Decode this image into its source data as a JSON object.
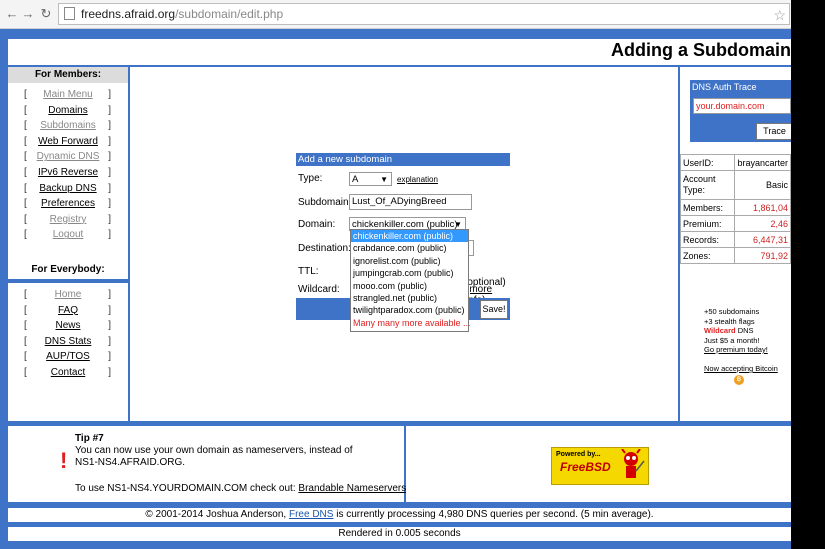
{
  "browser": {
    "url_host": "freedns.afraid.org",
    "url_path": "/subdomain/edit.php"
  },
  "header": {
    "title": "Adding a Subdomain"
  },
  "members": {
    "heading": "For Members:",
    "items": [
      {
        "label": "Main Menu"
      },
      {
        "label": "Domains"
      },
      {
        "label": "Subdomains"
      },
      {
        "label": "Web Forward"
      },
      {
        "label": "Dynamic DNS"
      },
      {
        "label": "IPv6 Reverse"
      },
      {
        "label": "Backup DNS"
      },
      {
        "label": "Preferences"
      },
      {
        "label": "Registry"
      },
      {
        "label": "Logout"
      }
    ]
  },
  "everybody": {
    "heading": "For Everybody:",
    "items": [
      {
        "label": "Home"
      },
      {
        "label": "FAQ"
      },
      {
        "label": "News"
      },
      {
        "label": "DNS Stats"
      },
      {
        "label": "AUP/TOS"
      },
      {
        "label": "Contact"
      }
    ]
  },
  "form": {
    "heading": "Add a new subdomain",
    "type_label": "Type:",
    "type_value": "A",
    "explanation_link": "explanation",
    "subdomain_label": "Subdomain:",
    "subdomain_value": "Lust_Of_ADyingBreed",
    "domain_label": "Domain:",
    "domain_value": "chickenkiller.com (public)",
    "destination_label": "Destination:",
    "ttl_label": "TTL:",
    "ttl_suffix": "s (optional)",
    "wildcard_label": "Wildcard:",
    "more_info_link": "(more info)",
    "save_label": "Save!"
  },
  "dropdown": {
    "options": [
      "chickenkiller.com (public)",
      "crabdance.com (public)",
      "ignorelist.com (public)",
      "jumpingcrab.com (public)",
      "mooo.com (public)",
      "strangled.net (public)",
      "twilightparadox.com (public)",
      "Many many more available ..."
    ]
  },
  "dns_trace": {
    "heading": "DNS Auth Trace",
    "placeholder": "your.domain.com",
    "button": "Trace"
  },
  "stats": {
    "rows": [
      {
        "label": "UserID:",
        "value": "brayancarter"
      },
      {
        "label": "Account Type:",
        "value": "Basic"
      },
      {
        "label": "Members:",
        "value": "1,861,04"
      },
      {
        "label": "Premium:",
        "value": "2,46"
      },
      {
        "label": "Records:",
        "value": "6,447,31"
      },
      {
        "label": "Zones:",
        "value": "791,92"
      }
    ]
  },
  "promo": {
    "line1": "+50 subdomains",
    "line2": "+3 stealth flags",
    "wildcard": "Wildcard",
    "line3_suffix": " DNS",
    "line4": "Just $5 a month!",
    "line5": "Go premium today!",
    "bitcoin": "Now accepting Bitcoin"
  },
  "tip": {
    "title": "Tip #7",
    "text": "You can now use your own domain as nameservers, instead of NS1-NS4.AFRAID.ORG.",
    "text2_prefix": "To use NS1-NS4.YOURDOMAIN.COM check out: ",
    "text2_link": "Brandable Nameservers"
  },
  "ad": {
    "small": "Powered by...",
    "big": "FreeBSD"
  },
  "footer": {
    "prefix": "© 2001-2014 Joshua Anderson, ",
    "link": "Free DNS",
    "suffix": " is currently processing 4,980 DNS queries per second. (5 min average).",
    "rendered": "Rendered in 0.005 seconds"
  }
}
